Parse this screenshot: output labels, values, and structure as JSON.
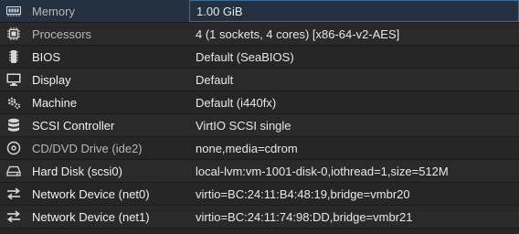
{
  "hardware": {
    "rows": [
      {
        "icon": "memory-icon",
        "name": "Memory",
        "value": "1.00 GiB"
      },
      {
        "icon": "processor-icon",
        "name": "Processors",
        "value": "4 (1 sockets, 4 cores) [x86-64-v2-AES]"
      },
      {
        "icon": "bios-icon",
        "name": "BIOS",
        "value": "Default (SeaBIOS)"
      },
      {
        "icon": "display-icon",
        "name": "Display",
        "value": "Default"
      },
      {
        "icon": "machine-icon",
        "name": "Machine",
        "value": "Default (i440fx)"
      },
      {
        "icon": "scsi-controller-icon",
        "name": "SCSI Controller",
        "value": "VirtIO SCSI single"
      },
      {
        "icon": "cdrom-icon",
        "name": "CD/DVD Drive (ide2)",
        "value": "none,media=cdrom"
      },
      {
        "icon": "hard-disk-icon",
        "name": "Hard Disk (scsi0)",
        "value": "local-lvm:vm-1001-disk-0,iothread=1,size=512M"
      },
      {
        "icon": "network-icon",
        "name": "Network Device (net0)",
        "value": "virtio=BC:24:11:B4:48:19,bridge=vmbr20"
      },
      {
        "icon": "network-icon",
        "name": "Network Device (net1)",
        "value": "virtio=BC:24:11:74:98:DD,bridge=vmbr21"
      }
    ]
  },
  "colors": {
    "background": "#262626",
    "selected_row": "#233140",
    "selected_border": "#3b6b93",
    "text": "#e8e8e8"
  }
}
